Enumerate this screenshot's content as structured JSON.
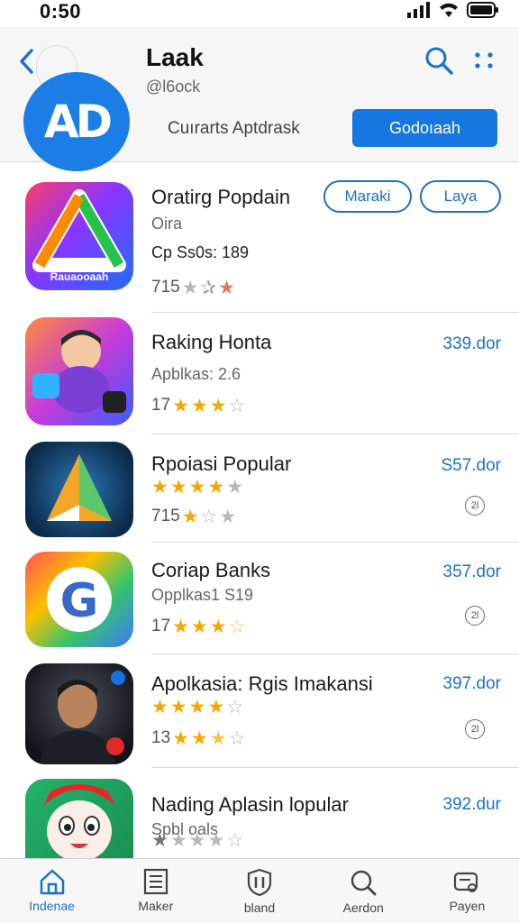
{
  "status_bar": {
    "time": "0:50"
  },
  "header": {
    "title": "Laak",
    "subtitle": "@l6ock",
    "search_text": "Cuırarts Aptdrask",
    "button_label": "Godoıaah",
    "logo_text": "AD"
  },
  "pills": [
    "Maraki",
    "Laya"
  ],
  "apps": [
    {
      "name": "Oratirg Popdain",
      "sub": "Oira",
      "extra": "Cp Ss0s: 189",
      "rating_prefix": "715",
      "icon_text": "Rauaooaah"
    },
    {
      "name": "Raking Honta",
      "sub": "Apblkas: 2.6",
      "rating_prefix": "17",
      "price": "339.dor"
    },
    {
      "name": "Rpoiasi Popular",
      "rating_prefix": "715",
      "price": "S57.dor",
      "badge": "2l"
    },
    {
      "name": "Coriap Banks",
      "sub": "Opplkas1 S19",
      "rating_prefix": "17",
      "price": "357.dor",
      "badge": "2l"
    },
    {
      "name": "Apolkasia: Rgis Imakansi",
      "rating_prefix": "13",
      "price": "397.dor",
      "badge": "2l"
    },
    {
      "name": "Nading Aplasin lopular",
      "sub": "Spbl oals",
      "price": "392.dur"
    }
  ],
  "tabs": [
    "Indenae",
    "Maker",
    "bland",
    "Aerdon",
    "Payen"
  ],
  "colors": {
    "accent": "#1b72c9",
    "button": "#1677e0",
    "star": "#f2a900"
  }
}
